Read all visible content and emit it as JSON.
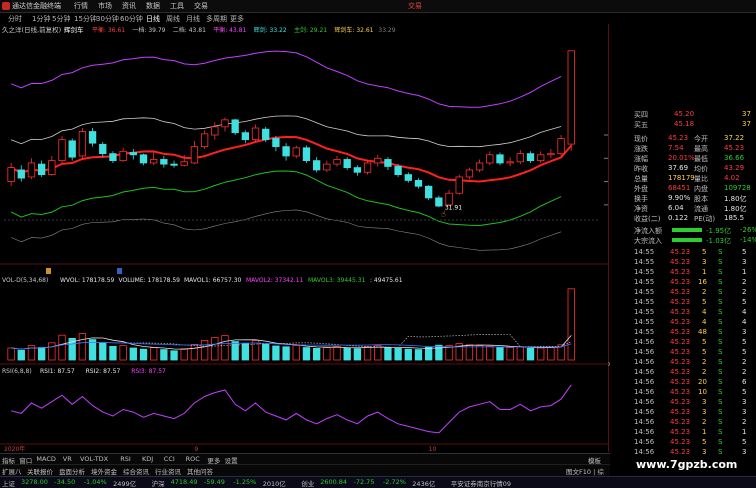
{
  "window": {
    "title": "通达信金融终端",
    "trade": "交易"
  },
  "menu": [
    "行情",
    "市场",
    "资讯",
    "数据",
    "工具",
    "交易"
  ],
  "periods": [
    {
      "label": "分时",
      "active": false
    },
    {
      "label": "1分钟",
      "active": false
    },
    {
      "label": "5分钟",
      "active": false
    },
    {
      "label": "15分钟",
      "active": false
    },
    {
      "label": "30分钟",
      "active": false
    },
    {
      "label": "60分钟",
      "active": false
    },
    {
      "label": "日线",
      "active": true
    },
    {
      "label": "周线",
      "active": false
    },
    {
      "label": "月线",
      "active": false
    },
    {
      "label": "多周期",
      "active": false
    },
    {
      "label": "更多",
      "active": false
    }
  ],
  "main_header": {
    "stock": "久之洋(日线,前复权)",
    "indicator": "辉剑车",
    "items": [
      {
        "text": "平衡: 36.61",
        "color": "#ff4040"
      },
      {
        "text": "一档: 39.79",
        "color": "#c8c8c8"
      },
      {
        "text": "二档: 43.81",
        "color": "#c8c8c8"
      },
      {
        "text": "平衡: 43.81",
        "color": "#ff40ff"
      },
      {
        "text": "辉剑: 33.22",
        "color": "#3ce6e6"
      },
      {
        "text": "主剑: 29.21",
        "color": "#2ecc2e"
      },
      {
        "text": "辉剑车: 32.61",
        "color": "#ffd24a"
      },
      {
        "text": "33.29",
        "color": "#808080"
      }
    ]
  },
  "price_axis": [
    "38.00",
    "36.00",
    "34.00",
    "32.00"
  ],
  "low_marker": "31.91",
  "vol_header": {
    "name": "VOL-D(5,34,68)",
    "items": [
      {
        "text": "WVOL: 178178.59",
        "color": "#e6e6e6"
      },
      {
        "text": "VOLUME: 178178.59",
        "color": "#e6e6e6"
      },
      {
        "text": "MAVOL1: 66757.30",
        "color": "#e6e6e6"
      },
      {
        "text": "MAVOL2: 37342.11",
        "color": "#ff40ff"
      },
      {
        "text": "MAVOL3: 39445.31",
        "color": "#2ecc2e"
      },
      {
        "text": ": 49475.61",
        "color": "#e6e6e6"
      }
    ]
  },
  "vol_axis": [
    "15000",
    "10000",
    "5000",
    "X10"
  ],
  "rsi_header": {
    "name": "RSI(6,8,8)",
    "items": [
      {
        "text": "RSI1: 87.57",
        "color": "#e6e6e6"
      },
      {
        "text": "RSI2: 87.57",
        "color": "#e6e6e6"
      },
      {
        "text": "RSI3: 87.57",
        "color": "#ff40ff"
      }
    ]
  },
  "rsi_axis": [
    "80.00",
    "60.00",
    "40.00",
    "20.00"
  ],
  "time_axis": {
    "left": "2020年",
    "month9": "9",
    "month10": "10"
  },
  "quote": {
    "asks": [
      {
        "label": "买四",
        "price": "45.20",
        "vol": "37"
      },
      {
        "label": "买五",
        "price": "45.18",
        "vol": "37"
      }
    ],
    "rows": [
      {
        "l1": "现价",
        "v1": "45.23",
        "c1": "red",
        "l2": "今开",
        "v2": "37.22",
        "c2": "yellow"
      },
      {
        "l1": "涨跌",
        "v1": "7.54",
        "c1": "red",
        "l2": "最高",
        "v2": "45.23",
        "c2": "red"
      },
      {
        "l1": "涨幅",
        "v1": "20.01%",
        "c1": "red",
        "l2": "最低",
        "v2": "36.66",
        "c2": "green"
      },
      {
        "l1": "昨收",
        "v1": "37.69",
        "c1": "white",
        "l2": "均价",
        "v2": "43.29",
        "c2": "red"
      },
      {
        "l1": "总量",
        "v1": "178179",
        "c1": "yellow",
        "l2": "量比",
        "v2": "4.02",
        "c2": "red"
      },
      {
        "l1": "外盘",
        "v1": "68451",
        "c1": "red",
        "l2": "内盘",
        "v2": "109728",
        "c2": "green"
      },
      {
        "l1": "换手",
        "v1": "9.90%",
        "c1": "white",
        "l2": "股本",
        "v2": "1.80亿",
        "c2": "white"
      },
      {
        "l1": "净资",
        "v1": "6.04",
        "c1": "white",
        "l2": "流通",
        "v2": "1.80亿",
        "c2": "white"
      },
      {
        "l1": "收益(二)",
        "v1": "0.122",
        "c1": "white",
        "l2": "PE(动)",
        "v2": "185.5",
        "c2": "white"
      }
    ],
    "flows": [
      {
        "label": "净流入额",
        "value": "-1.95亿",
        "pct": "-26%"
      },
      {
        "label": "大宗流入",
        "value": "-1.03亿",
        "pct": "-14%"
      }
    ],
    "ticks": [
      {
        "t": "14:55",
        "p": "45.23",
        "v": "5",
        "s": "S",
        "n": "5"
      },
      {
        "t": "14:55",
        "p": "45.23",
        "v": "3",
        "s": "S",
        "n": "3"
      },
      {
        "t": "14:55",
        "p": "45.23",
        "v": "1",
        "s": "S",
        "n": "1"
      },
      {
        "t": "14:55",
        "p": "45.23",
        "v": "16",
        "s": "S",
        "n": "2"
      },
      {
        "t": "14:55",
        "p": "45.23",
        "v": "2",
        "s": "S",
        "n": "2"
      },
      {
        "t": "14:55",
        "p": "45.23",
        "v": "5",
        "s": "S",
        "n": "5"
      },
      {
        "t": "14:55",
        "p": "45.23",
        "v": "4",
        "s": "S",
        "n": "4"
      },
      {
        "t": "14:55",
        "p": "45.23",
        "v": "4",
        "s": "S",
        "n": "4"
      },
      {
        "t": "14:55",
        "p": "45.23",
        "v": "48",
        "s": "S",
        "n": "3"
      },
      {
        "t": "14:56",
        "p": "45.23",
        "v": "5",
        "s": "S",
        "n": "5"
      },
      {
        "t": "14:56",
        "p": "45.23",
        "v": "5",
        "s": "S",
        "n": "5"
      },
      {
        "t": "14:56",
        "p": "45.23",
        "v": "2",
        "s": "S",
        "n": "2"
      },
      {
        "t": "14:56",
        "p": "45.23",
        "v": "2",
        "s": "S",
        "n": "2"
      },
      {
        "t": "14:56",
        "p": "45.23",
        "v": "20",
        "s": "S",
        "n": "6"
      },
      {
        "t": "14:56",
        "p": "45.23",
        "v": "10",
        "s": "S",
        "n": "5"
      },
      {
        "t": "14:56",
        "p": "45.23",
        "v": "3",
        "s": "S",
        "n": "3"
      },
      {
        "t": "14:56",
        "p": "45.23",
        "v": "3",
        "s": "S",
        "n": "3"
      },
      {
        "t": "14:56",
        "p": "45.23",
        "v": "2",
        "s": "S",
        "n": "2"
      },
      {
        "t": "14:56",
        "p": "45.23",
        "v": "1",
        "s": "S",
        "n": "1"
      },
      {
        "t": "14:56",
        "p": "45.23",
        "v": "5",
        "s": "S",
        "n": "5"
      },
      {
        "t": "14:56",
        "p": "45.23",
        "v": "3",
        "s": "S",
        "n": "3"
      }
    ]
  },
  "bottom_tabs": [
    "指标",
    "窗口",
    "MACD",
    "VR",
    "VOL-TDX",
    "RSI",
    "KDJ",
    "CCI",
    "ROC",
    "更多",
    "设置"
  ],
  "bottom_tabs2": [
    "扩展八",
    "关联报价",
    "盘面分析",
    "境外资金",
    "综合资讯",
    "行业资讯",
    "其他问答"
  ],
  "status": [
    {
      "text": "上证",
      "color": "#c0c0c0"
    },
    {
      "text": "3278.00",
      "color": "#2ecc2e"
    },
    {
      "text": "-34.50",
      "color": "#2ecc2e"
    },
    {
      "text": "-1.04%",
      "color": "#2ecc2e"
    },
    {
      "text": "2499亿",
      "color": "#c0c0c0"
    },
    {
      "text": "沪深",
      "color": "#c0c0c0"
    },
    {
      "text": "4718.49",
      "color": "#2ecc2e"
    },
    {
      "text": "-59.49",
      "color": "#2ecc2e"
    },
    {
      "text": "-1.25%",
      "color": "#2ecc2e"
    },
    {
      "text": "2010亿",
      "color": "#c0c0c0"
    },
    {
      "text": "创业",
      "color": "#c0c0c0"
    },
    {
      "text": "2600.84",
      "color": "#2ecc2e"
    },
    {
      "text": "-72.75",
      "color": "#2ecc2e"
    },
    {
      "text": "-2.72%",
      "color": "#2ecc2e"
    },
    {
      "text": "2436亿",
      "color": "#c0c0c0"
    },
    {
      "text": "平安证券南京行情09",
      "color": "#c0c0c0"
    }
  ],
  "right_tab": "模板",
  "right_tab2": "图文F10 | 综",
  "watermark": "www.7gpzb.com",
  "candles": [
    [
      34,
      35.2,
      33.6,
      35.6
    ],
    [
      35,
      34.3,
      34,
      35.4
    ],
    [
      34.4,
      35.6,
      34.2,
      36
    ],
    [
      35.5,
      34.6,
      34.4,
      35.8
    ],
    [
      34.6,
      35.8,
      34.5,
      36.2
    ],
    [
      35.8,
      37.6,
      35.6,
      37.9
    ],
    [
      37.5,
      36.1,
      35.8,
      37.7
    ],
    [
      36.2,
      38.3,
      36,
      38.6
    ],
    [
      38.3,
      37.3,
      37,
      38.6
    ],
    [
      37.2,
      36.4,
      36.1,
      37.4
    ],
    [
      36.4,
      35.8,
      35.6,
      36.6
    ],
    [
      35.8,
      36.6,
      35.7,
      36.9
    ],
    [
      36.5,
      36.3,
      35.9,
      36.8
    ],
    [
      36.3,
      35.6,
      35.4,
      36.4
    ],
    [
      35.6,
      35.9,
      35.4,
      36.5
    ],
    [
      35.9,
      35.5,
      35.2,
      36.2
    ],
    [
      35.5,
      35.4,
      35.2,
      35.8
    ],
    [
      35.4,
      35.7,
      35.3,
      36.3
    ],
    [
      35.6,
      37,
      35.5,
      37.5
    ],
    [
      37,
      38.1,
      36.8,
      38.4
    ],
    [
      38,
      38.7,
      37.6,
      39.1
    ],
    [
      38.7,
      39.3,
      38.3,
      39.5
    ],
    [
      39.3,
      38.2,
      38,
      39.4
    ],
    [
      38.2,
      37.6,
      37.3,
      38.4
    ],
    [
      37.6,
      38.6,
      37.4,
      38.9
    ],
    [
      38.5,
      37.6,
      37.4,
      38.7
    ],
    [
      37.7,
      37,
      36.6,
      37.9
    ],
    [
      37,
      36.2,
      35.8,
      37.3
    ],
    [
      36.2,
      36.9,
      36,
      37.1
    ],
    [
      36.9,
      35.8,
      35.6,
      37.1
    ],
    [
      35.8,
      35,
      34.8,
      36.1
    ],
    [
      35,
      35.5,
      34.8,
      35.8
    ],
    [
      35.5,
      35.9,
      35.3,
      36.2
    ],
    [
      35.9,
      35.2,
      35,
      36.1
    ],
    [
      35.2,
      34.8,
      34.5,
      35.4
    ],
    [
      34.8,
      35.6,
      34.6,
      35.9
    ],
    [
      35.6,
      36,
      35.3,
      36.3
    ],
    [
      35.9,
      35.3,
      35,
      36.1
    ],
    [
      35.3,
      34.6,
      34.4,
      35.5
    ],
    [
      34.6,
      34.1,
      33.9,
      34.8
    ],
    [
      34.1,
      33.6,
      33.4,
      34.3
    ],
    [
      33.6,
      32.6,
      32.4,
      33.7
    ],
    [
      32.6,
      31.9,
      31.8,
      32.8
    ],
    [
      32,
      33,
      31.9,
      33.3
    ],
    [
      33,
      34.4,
      32.9,
      34.6
    ],
    [
      34.4,
      35,
      34.2,
      35.2
    ],
    [
      35,
      35.6,
      34.8,
      35.9
    ],
    [
      35.6,
      36.3,
      35.4,
      36.6
    ],
    [
      36.3,
      35.6,
      35.4,
      36.5
    ],
    [
      35.6,
      35.7,
      35.3,
      36.1
    ],
    [
      35.7,
      36.4,
      35.5,
      36.7
    ],
    [
      36.4,
      35.8,
      35.6,
      36.6
    ],
    [
      35.8,
      36.3,
      35.6,
      36.6
    ],
    [
      36.3,
      36.4,
      36,
      36.8
    ],
    [
      36.4,
      37.69,
      36.2,
      38
    ],
    [
      37.22,
      45.23,
      36.66,
      45.23
    ]
  ],
  "volumes": [
    3000,
    2400,
    3600,
    3100,
    4300,
    6200,
    5400,
    6600,
    5100,
    4200,
    3400,
    3600,
    3000,
    2700,
    3100,
    2600,
    2300,
    2800,
    3900,
    4900,
    5600,
    6100,
    4600,
    4100,
    4900,
    3900,
    3500,
    3300,
    3600,
    3100,
    2900,
    3100,
    3400,
    3000,
    2800,
    3300,
    3600,
    3100,
    2900,
    2700,
    2600,
    3200,
    3700,
    3600,
    4100,
    3800,
    3600,
    3400,
    3200,
    3100,
    3300,
    2900,
    3000,
    3200,
    3800,
    17800
  ],
  "rsi": [
    48,
    44,
    60,
    52,
    62,
    72,
    58,
    70,
    56,
    46,
    40,
    50,
    46,
    38,
    44,
    40,
    36,
    44,
    60,
    70,
    76,
    80,
    58,
    48,
    60,
    46,
    40,
    34,
    44,
    34,
    28,
    36,
    42,
    34,
    28,
    40,
    46,
    36,
    28,
    24,
    20,
    16,
    14,
    30,
    46,
    54,
    58,
    62,
    50,
    50,
    58,
    48,
    54,
    56,
    66,
    88
  ]
}
